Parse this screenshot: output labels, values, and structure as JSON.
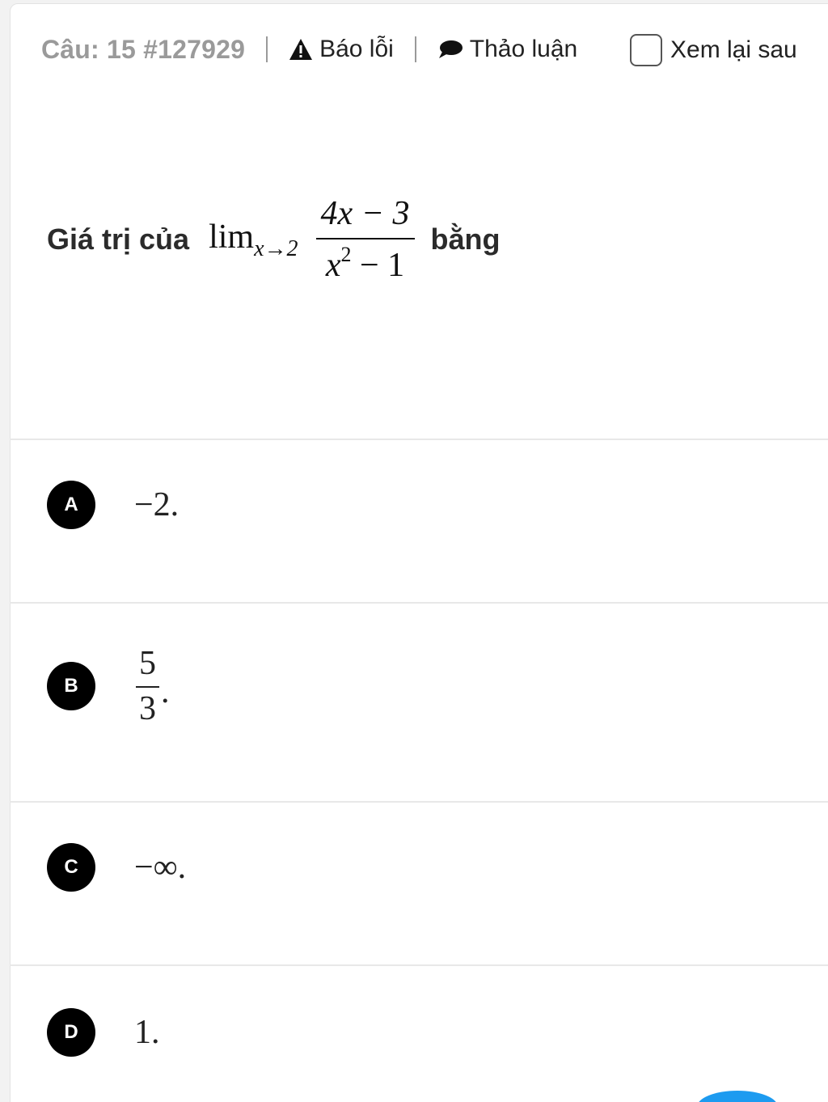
{
  "header": {
    "question_label": "Câu: 15 #127929",
    "report_label": "Báo lỗi",
    "discuss_label": "Thảo luận",
    "review_later_label": "Xem lại sau"
  },
  "question": {
    "prefix": "Giá trị của",
    "lim": "lim",
    "lim_sub": "x→2",
    "numerator": "4x − 3",
    "denominator_base": "x",
    "denominator_exp": "2",
    "denominator_rest": " − 1",
    "suffix": "bằng"
  },
  "options": [
    {
      "letter": "A",
      "value": "−2."
    },
    {
      "letter": "B",
      "numerator": "5",
      "denominator": "3",
      "trailing": "."
    },
    {
      "letter": "C",
      "value": "−∞."
    },
    {
      "letter": "D",
      "value": "1."
    }
  ],
  "colors": {
    "accent": "#1d9bf0",
    "badge": "#000000",
    "muted": "#9a9a9a"
  }
}
